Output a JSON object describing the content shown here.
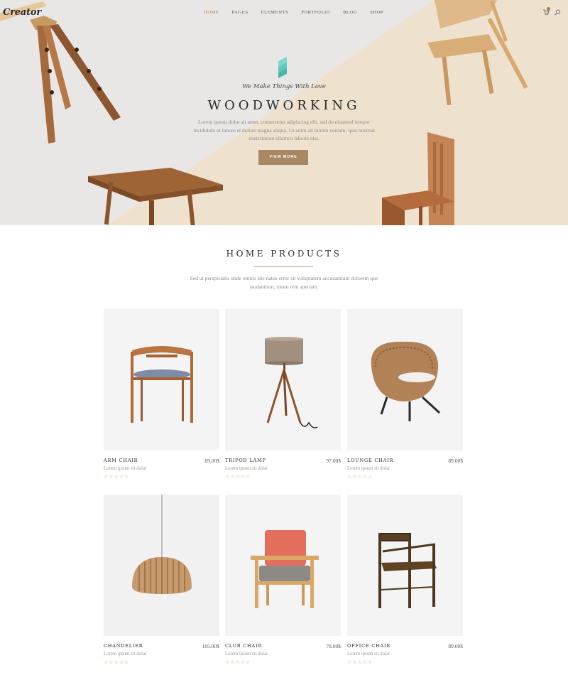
{
  "brand": {
    "logo_text": "Creator"
  },
  "nav": {
    "items": [
      {
        "label": "HOME",
        "active": true
      },
      {
        "label": "PAGES",
        "active": false
      },
      {
        "label": "ELEMENTS",
        "active": false
      },
      {
        "label": "PORTFOLIO",
        "active": false
      },
      {
        "label": "BLOG",
        "active": false
      },
      {
        "label": "SHOP",
        "active": false
      }
    ]
  },
  "header_icons": {
    "cart": "cart-icon",
    "search": "search-icon"
  },
  "hero": {
    "tagline": "We Make Things With Love",
    "title": "WOODWORKING",
    "text": "Lorem ipsum dolor sit amet, consectetur adipiscing elit, sed do eiusmod tempor incididunt ut labore et dolore magna aliqua. Ut enim ad minim veniam, quis nostrud exercitation ullamco laboris nisi.",
    "button_label": "VIEW MORE"
  },
  "products_section": {
    "title": "HOME PRODUCTS",
    "text": "Sed ut perspiciatis unde omnis iste natus error sit voluptatem accusantium dolorem que laudantium, totam rem aperiam.",
    "items": [
      {
        "name": "ARM CHAIR",
        "price": "89.00$",
        "desc": "Lorem ipsum sit dolar",
        "rating": "☆☆☆☆☆"
      },
      {
        "name": "TRIPOD LAMP",
        "price": "97.00$",
        "desc": "Lorem ipsum sit dolar",
        "rating": "☆☆☆☆☆"
      },
      {
        "name": "LOUNGE CHAIR",
        "price": "89.00$",
        "desc": "Lorem ipsum sit dolar",
        "rating": "☆☆☆☆☆"
      },
      {
        "name": "CHANDELIER",
        "price": "105.00$",
        "desc": "Lorem ipsum sit dolar",
        "rating": "☆☆☆☆☆"
      },
      {
        "name": "CLUB CHAIR",
        "price": "78.00$",
        "desc": "Lorem ipsum sit dolar",
        "rating": "☆☆☆☆☆"
      },
      {
        "name": "OFFICE CHAIR",
        "price": "89.00$",
        "desc": "Lorem ipsum sit dolar",
        "rating": "☆☆☆☆☆"
      }
    ]
  },
  "colors": {
    "accent": "#b07a4a",
    "button": "#a88763",
    "hero_beige": "#eee2cf",
    "hero_grey": "#e9e7e6",
    "mark": "#5fc8c0"
  }
}
